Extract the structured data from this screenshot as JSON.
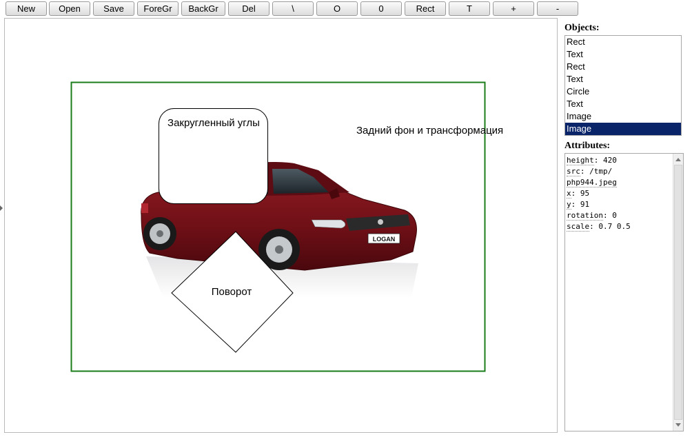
{
  "toolbar": {
    "buttons": [
      "New",
      "Open",
      "Save",
      "ForeGr",
      "BackGr",
      "Del",
      "\\",
      "O",
      "0",
      "Rect",
      "T",
      "+",
      "-"
    ]
  },
  "canvas": {
    "texts": {
      "rounded": "Закругленный углы",
      "background": "Задний фон и трансформация",
      "rotation": "Поворот"
    },
    "car_plate": "LOGAN",
    "colors": {
      "frame": "#1a7d1a",
      "car_body": "#6e0f16"
    }
  },
  "objects_panel": {
    "title": "Objects:",
    "items": [
      "Rect",
      "Text",
      "Rect",
      "Text",
      "Circle",
      "Text",
      "Image",
      "Image"
    ],
    "selected_index": 7
  },
  "attributes_panel": {
    "title": "Attributes:",
    "lines": [
      {
        "key": "height",
        "value": ": 420"
      },
      {
        "key": "src",
        "value": ": /tmp/"
      },
      {
        "key": "php944.jpeg",
        "value": ""
      },
      {
        "key": "x",
        "value": ": 95"
      },
      {
        "key": "y",
        "value": ": 91"
      },
      {
        "key": "rotation",
        "value": ": 0"
      },
      {
        "key": "scale",
        "value": ": 0.7 0.5"
      }
    ]
  }
}
